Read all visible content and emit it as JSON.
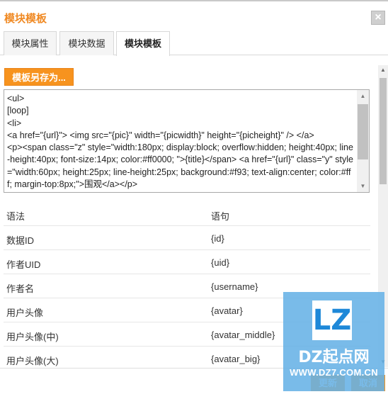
{
  "window": {
    "title": "模块模板",
    "close_label": "×"
  },
  "tabs": [
    {
      "label": "模块属性"
    },
    {
      "label": "模块数据"
    },
    {
      "label": "模块模板",
      "active": true
    }
  ],
  "toolbar": {
    "save_as_label": "模板另存为..."
  },
  "editor": {
    "content": "<ul>\n[loop]\n<li>\n<a href=\"{url}\"> <img src=\"{pic}\" width=\"{picwidth}\" height=\"{picheight}\" /> </a>\n<p><span class=\"z\" style=\"width:180px; display:block; overflow:hidden; height:40px; line-height:40px; font-size:14px; color:#ff0000; \">{title}</span> <a href=\"{url}\" class=\"y\" style=\"width:60px; height:25px; line-height:25px; background:#f93; text-align:center; color:#fff; margin-top:8px;\">围观</a></p>"
  },
  "properties": {
    "header": {
      "name": "语法",
      "value": "语句"
    },
    "rows": [
      {
        "name": "数据ID",
        "value": "{id}"
      },
      {
        "name": "作者UID",
        "value": "{uid}"
      },
      {
        "name": "作者名",
        "value": "{username}"
      },
      {
        "name": "用户头像",
        "value": "{avatar}"
      },
      {
        "name": "用户头像(中)",
        "value": "{avatar_middle}"
      },
      {
        "name": "用户头像(大)",
        "value": "{avatar_big}"
      }
    ]
  },
  "footer": {
    "update_label": "更新",
    "cancel_label": "取消"
  },
  "watermark": {
    "logo_text": "LZ",
    "name": "DZ起点网",
    "url": "WWW.DZ7.COM.CN"
  },
  "colors": {
    "accent": "#f7931e",
    "title": "#f08a24",
    "watermark_bg": "#66b2e6"
  }
}
